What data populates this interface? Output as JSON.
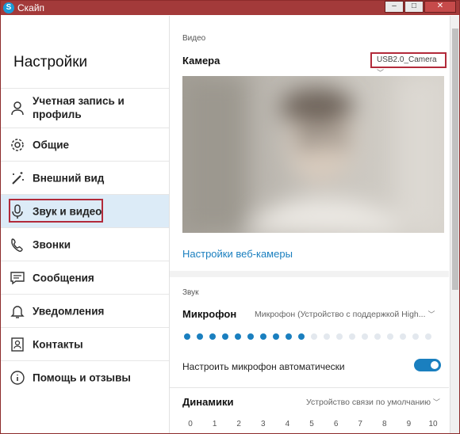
{
  "window": {
    "title": "Скайп",
    "app_icon": "skype-icon",
    "accent": "#a33a3a"
  },
  "sidebar": {
    "title": "Настройки",
    "items": [
      {
        "label": "Учетная запись и профиль",
        "icon": "person-icon"
      },
      {
        "label": "Общие",
        "icon": "gear-icon"
      },
      {
        "label": "Внешний вид",
        "icon": "magic-wand-icon"
      },
      {
        "label": "Звук и видео",
        "icon": "microphone-icon",
        "active": true
      },
      {
        "label": "Звонки",
        "icon": "phone-icon"
      },
      {
        "label": "Сообщения",
        "icon": "chat-icon"
      },
      {
        "label": "Уведомления",
        "icon": "bell-icon"
      },
      {
        "label": "Контакты",
        "icon": "contacts-icon"
      },
      {
        "label": "Помощь и отзывы",
        "icon": "info-icon"
      }
    ]
  },
  "video": {
    "section_label": "Видео",
    "camera_label": "Камера",
    "camera_value": "USB2.0_Camera",
    "webcam_settings_link": "Настройки веб-камеры"
  },
  "audio": {
    "section_label": "Звук",
    "microphone_label": "Микрофон",
    "microphone_value": "Микрофон (Устройство с поддержкой High...",
    "mic_level": {
      "filled": 10,
      "total": 20
    },
    "auto_mic_label": "Настроить микрофон автоматически",
    "auto_mic_enabled": true,
    "speakers_label": "Динамики",
    "speakers_value": "Устройство связи по умолчанию",
    "volume_ticks": [
      "0",
      "1",
      "2",
      "3",
      "4",
      "5",
      "6",
      "7",
      "8",
      "9",
      "10"
    ]
  },
  "colors": {
    "accent_blue": "#1a7fbf",
    "active_bg": "#dcebf7",
    "highlight": "#b22a3a"
  }
}
